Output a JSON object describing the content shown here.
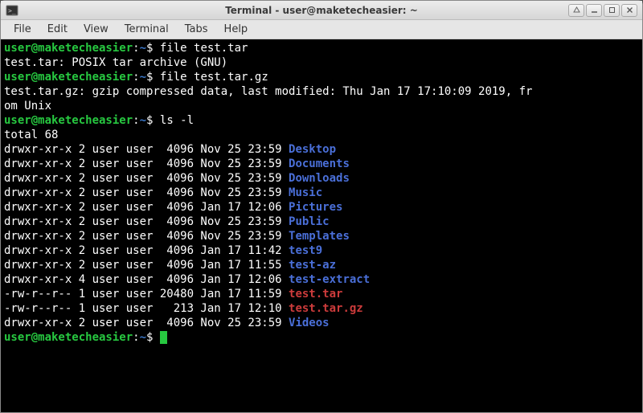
{
  "window": {
    "title": "Terminal - user@maketecheasier: ~"
  },
  "menubar": {
    "items": [
      "File",
      "Edit",
      "View",
      "Terminal",
      "Tabs",
      "Help"
    ]
  },
  "prompt": {
    "user_host": "user@maketecheasier",
    "sep": ":",
    "path": "~",
    "symbol": "$"
  },
  "commands": {
    "c1": "file test.tar",
    "c2": "file test.tar.gz",
    "c3": "ls -l"
  },
  "output": {
    "o1": "test.tar: POSIX tar archive (GNU)",
    "o2a": "test.tar.gz: gzip compressed data, last modified: Thu Jan 17 17:10:09 2019, fr",
    "o2b": "om Unix",
    "total": "total 68"
  },
  "ls": [
    {
      "meta": "drwxr-xr-x 2 user user  4096 Nov 25 23:59 ",
      "name": "Desktop",
      "cls": "dir"
    },
    {
      "meta": "drwxr-xr-x 2 user user  4096 Nov 25 23:59 ",
      "name": "Documents",
      "cls": "dir"
    },
    {
      "meta": "drwxr-xr-x 2 user user  4096 Nov 25 23:59 ",
      "name": "Downloads",
      "cls": "dir"
    },
    {
      "meta": "drwxr-xr-x 2 user user  4096 Nov 25 23:59 ",
      "name": "Music",
      "cls": "dir"
    },
    {
      "meta": "drwxr-xr-x 2 user user  4096 Jan 17 12:06 ",
      "name": "Pictures",
      "cls": "dir"
    },
    {
      "meta": "drwxr-xr-x 2 user user  4096 Nov 25 23:59 ",
      "name": "Public",
      "cls": "dir"
    },
    {
      "meta": "drwxr-xr-x 2 user user  4096 Nov 25 23:59 ",
      "name": "Templates",
      "cls": "dir"
    },
    {
      "meta": "drwxr-xr-x 2 user user  4096 Jan 17 11:42 ",
      "name": "test9",
      "cls": "dir"
    },
    {
      "meta": "drwxr-xr-x 2 user user  4096 Jan 17 11:55 ",
      "name": "test-az",
      "cls": "dir"
    },
    {
      "meta": "drwxr-xr-x 4 user user  4096 Jan 17 12:06 ",
      "name": "test-extract",
      "cls": "dir"
    },
    {
      "meta": "-rw-r--r-- 1 user user 20480 Jan 17 11:59 ",
      "name": "test.tar",
      "cls": "arch"
    },
    {
      "meta": "-rw-r--r-- 1 user user   213 Jan 17 12:10 ",
      "name": "test.tar.gz",
      "cls": "arch"
    },
    {
      "meta": "drwxr-xr-x 2 user user  4096 Nov 25 23:59 ",
      "name": "Videos",
      "cls": "dir"
    }
  ]
}
